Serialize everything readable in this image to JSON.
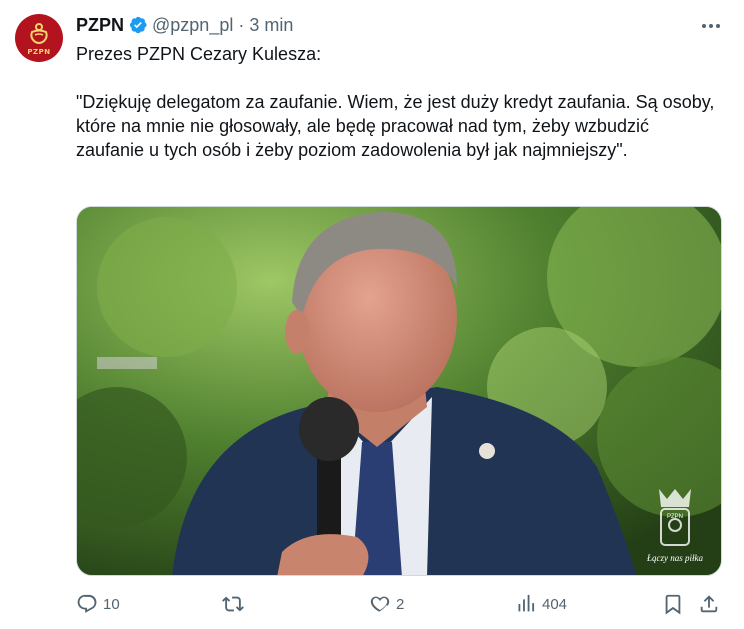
{
  "author": {
    "name": "PZPN",
    "handle": "@pzpn_pl",
    "separator": "·",
    "time": "3 min",
    "avatar_text": "PZPN",
    "avatar_color": "#b3131e",
    "verified_color": "#1d9bf0"
  },
  "tweet": {
    "lines": [
      "Prezes PZPN Cezary Kulesza:",
      "\"Dziękuję delegatom za zaufanie. Wiem, że jest duży kredyt zaufania. Są osoby, które na mnie nie głosowały, ale będę pracował nad tym, żeby wzbudzić zaufanie u tych osób i żeby poziom zadowolenia był jak najmniejszy\"."
    ]
  },
  "media": {
    "watermark_text": "PZPN",
    "watermark_slogan": "Łączy nas piłka"
  },
  "actions": {
    "reply_count": "10",
    "retweet_count": "",
    "like_count": "2",
    "views_count": "404"
  },
  "icons": [
    "more-icon",
    "reply-icon",
    "retweet-icon",
    "like-icon",
    "views-icon",
    "bookmark-icon",
    "share-icon",
    "verified-icon"
  ]
}
